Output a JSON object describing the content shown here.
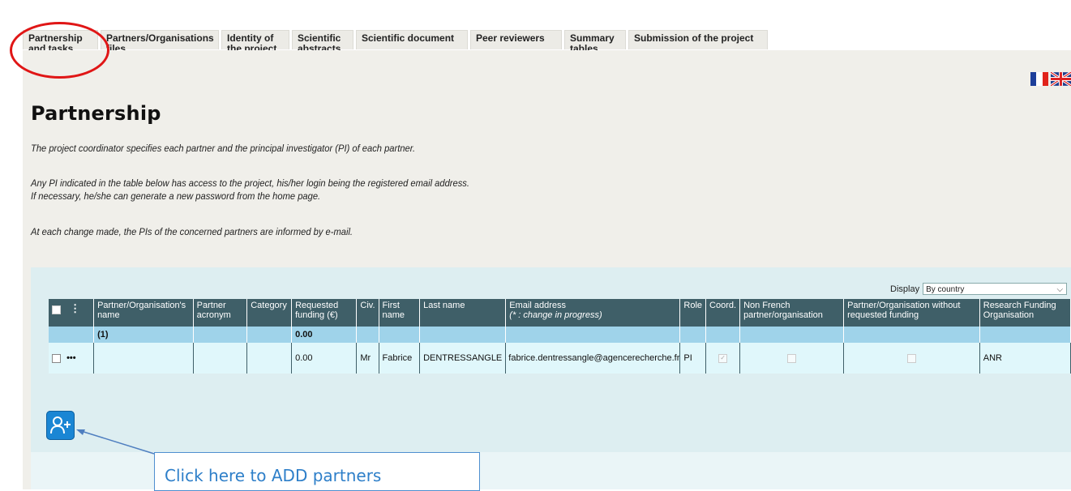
{
  "tabs": [
    {
      "line1": "Partnership",
      "line2": "and tasks"
    },
    {
      "line1": "Partners/Organisations",
      "line2": "files"
    },
    {
      "line1": "Identity of",
      "line2": "the project"
    },
    {
      "line1": "Scientific",
      "line2": "abstracts"
    },
    {
      "line1": "Scientific document",
      "line2": ""
    },
    {
      "line1": "Peer reviewers",
      "line2": ""
    },
    {
      "line1": "Summary",
      "line2": "tables"
    },
    {
      "line1": "Submission of the project",
      "line2": ""
    }
  ],
  "page": {
    "title": "Partnership",
    "para1": "The project coordinator specifies each partner and the principal investigator (PI) of each partner.",
    "para2a": "Any PI indicated in the table below has access to the project, his/her login being the registered email address.",
    "para2b": "If necessary, he/she can generate a new password from the home page.",
    "para3": "At each change made, the PIs of the concerned partners are informed by e-mail."
  },
  "display": {
    "label": "Display",
    "value": "By country"
  },
  "table": {
    "headers": {
      "name": "Partner/Organisation's name",
      "acronym": "Partner acronym",
      "category": "Category",
      "funding": "Requested funding (€)",
      "civ": "Civ.",
      "first": "First name",
      "last": "Last name",
      "email": "Email address",
      "email_note": "(* : change in progress)",
      "role": "Role",
      "coord": "Coord.",
      "nonfrench": "Non French partner/organisation",
      "nofunding": "Partner/Organisation without requested funding",
      "rfo": "Research Funding Organisation"
    },
    "group": {
      "label": "(1)",
      "funding": "0.00"
    },
    "rows": [
      {
        "funding": "0.00",
        "civ": "Mr",
        "first": "Fabrice",
        "last": "DENTRESSANGLE",
        "email": "fabrice.dentressangle@agencerecherche.fr",
        "role": "PI",
        "rfo": "ANR"
      }
    ]
  },
  "callout": "Click here to ADD partners",
  "colors": {
    "header": "#3f5f68",
    "group_row": "#9fd3ea",
    "data_row": "#e0f7fb",
    "highlight": "#e01616",
    "add_button": "#1a86d4"
  }
}
